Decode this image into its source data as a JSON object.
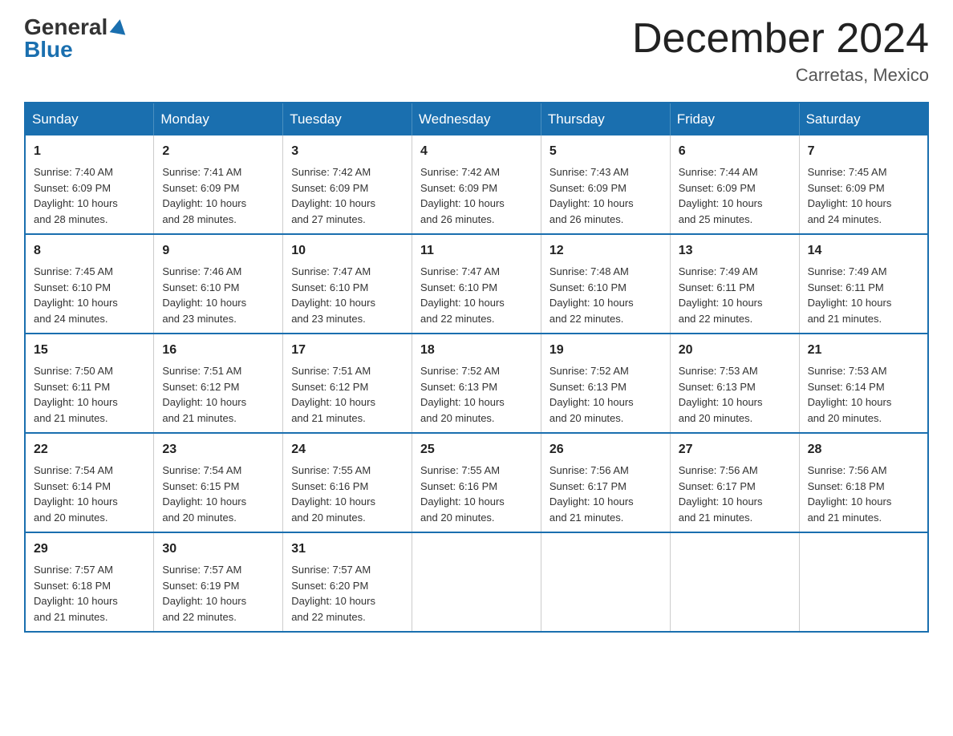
{
  "logo": {
    "general": "General",
    "blue": "Blue"
  },
  "title": "December 2024",
  "location": "Carretas, Mexico",
  "days_of_week": [
    "Sunday",
    "Monday",
    "Tuesday",
    "Wednesday",
    "Thursday",
    "Friday",
    "Saturday"
  ],
  "weeks": [
    [
      {
        "day": "1",
        "sunrise": "7:40 AM",
        "sunset": "6:09 PM",
        "daylight": "10 hours and 28 minutes."
      },
      {
        "day": "2",
        "sunrise": "7:41 AM",
        "sunset": "6:09 PM",
        "daylight": "10 hours and 28 minutes."
      },
      {
        "day": "3",
        "sunrise": "7:42 AM",
        "sunset": "6:09 PM",
        "daylight": "10 hours and 27 minutes."
      },
      {
        "day": "4",
        "sunrise": "7:42 AM",
        "sunset": "6:09 PM",
        "daylight": "10 hours and 26 minutes."
      },
      {
        "day": "5",
        "sunrise": "7:43 AM",
        "sunset": "6:09 PM",
        "daylight": "10 hours and 26 minutes."
      },
      {
        "day": "6",
        "sunrise": "7:44 AM",
        "sunset": "6:09 PM",
        "daylight": "10 hours and 25 minutes."
      },
      {
        "day": "7",
        "sunrise": "7:45 AM",
        "sunset": "6:09 PM",
        "daylight": "10 hours and 24 minutes."
      }
    ],
    [
      {
        "day": "8",
        "sunrise": "7:45 AM",
        "sunset": "6:10 PM",
        "daylight": "10 hours and 24 minutes."
      },
      {
        "day": "9",
        "sunrise": "7:46 AM",
        "sunset": "6:10 PM",
        "daylight": "10 hours and 23 minutes."
      },
      {
        "day": "10",
        "sunrise": "7:47 AM",
        "sunset": "6:10 PM",
        "daylight": "10 hours and 23 minutes."
      },
      {
        "day": "11",
        "sunrise": "7:47 AM",
        "sunset": "6:10 PM",
        "daylight": "10 hours and 22 minutes."
      },
      {
        "day": "12",
        "sunrise": "7:48 AM",
        "sunset": "6:10 PM",
        "daylight": "10 hours and 22 minutes."
      },
      {
        "day": "13",
        "sunrise": "7:49 AM",
        "sunset": "6:11 PM",
        "daylight": "10 hours and 22 minutes."
      },
      {
        "day": "14",
        "sunrise": "7:49 AM",
        "sunset": "6:11 PM",
        "daylight": "10 hours and 21 minutes."
      }
    ],
    [
      {
        "day": "15",
        "sunrise": "7:50 AM",
        "sunset": "6:11 PM",
        "daylight": "10 hours and 21 minutes."
      },
      {
        "day": "16",
        "sunrise": "7:51 AM",
        "sunset": "6:12 PM",
        "daylight": "10 hours and 21 minutes."
      },
      {
        "day": "17",
        "sunrise": "7:51 AM",
        "sunset": "6:12 PM",
        "daylight": "10 hours and 21 minutes."
      },
      {
        "day": "18",
        "sunrise": "7:52 AM",
        "sunset": "6:13 PM",
        "daylight": "10 hours and 20 minutes."
      },
      {
        "day": "19",
        "sunrise": "7:52 AM",
        "sunset": "6:13 PM",
        "daylight": "10 hours and 20 minutes."
      },
      {
        "day": "20",
        "sunrise": "7:53 AM",
        "sunset": "6:13 PM",
        "daylight": "10 hours and 20 minutes."
      },
      {
        "day": "21",
        "sunrise": "7:53 AM",
        "sunset": "6:14 PM",
        "daylight": "10 hours and 20 minutes."
      }
    ],
    [
      {
        "day": "22",
        "sunrise": "7:54 AM",
        "sunset": "6:14 PM",
        "daylight": "10 hours and 20 minutes."
      },
      {
        "day": "23",
        "sunrise": "7:54 AM",
        "sunset": "6:15 PM",
        "daylight": "10 hours and 20 minutes."
      },
      {
        "day": "24",
        "sunrise": "7:55 AM",
        "sunset": "6:16 PM",
        "daylight": "10 hours and 20 minutes."
      },
      {
        "day": "25",
        "sunrise": "7:55 AM",
        "sunset": "6:16 PM",
        "daylight": "10 hours and 20 minutes."
      },
      {
        "day": "26",
        "sunrise": "7:56 AM",
        "sunset": "6:17 PM",
        "daylight": "10 hours and 21 minutes."
      },
      {
        "day": "27",
        "sunrise": "7:56 AM",
        "sunset": "6:17 PM",
        "daylight": "10 hours and 21 minutes."
      },
      {
        "day": "28",
        "sunrise": "7:56 AM",
        "sunset": "6:18 PM",
        "daylight": "10 hours and 21 minutes."
      }
    ],
    [
      {
        "day": "29",
        "sunrise": "7:57 AM",
        "sunset": "6:18 PM",
        "daylight": "10 hours and 21 minutes."
      },
      {
        "day": "30",
        "sunrise": "7:57 AM",
        "sunset": "6:19 PM",
        "daylight": "10 hours and 22 minutes."
      },
      {
        "day": "31",
        "sunrise": "7:57 AM",
        "sunset": "6:20 PM",
        "daylight": "10 hours and 22 minutes."
      },
      null,
      null,
      null,
      null
    ]
  ],
  "labels": {
    "sunrise": "Sunrise:",
    "sunset": "Sunset:",
    "daylight": "Daylight:"
  }
}
